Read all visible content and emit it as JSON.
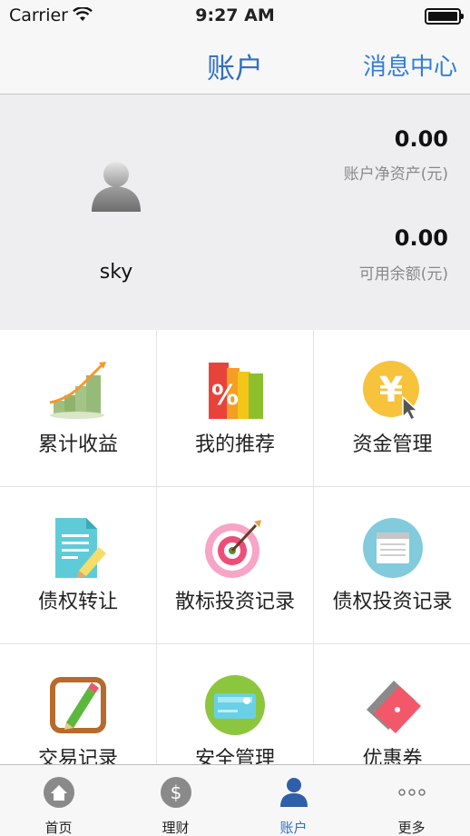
{
  "status_bar": {
    "carrier": "Carrier",
    "time": "9:27 AM"
  },
  "navbar": {
    "title": "账户",
    "right_button": "消息中心"
  },
  "account": {
    "username": "sky",
    "net_assets_value": "0.00",
    "net_assets_label": "账户净资产(元)",
    "balance_value": "0.00",
    "balance_label": "可用余额(元)"
  },
  "menu": [
    {
      "label": "累计收益",
      "icon": "earnings-chart-icon"
    },
    {
      "label": "我的推荐",
      "icon": "recommend-percent-icon"
    },
    {
      "label": "资金管理",
      "icon": "yen-coin-icon"
    },
    {
      "label": "债权转让",
      "icon": "document-edit-icon"
    },
    {
      "label": "散标投资记录",
      "icon": "target-dart-icon"
    },
    {
      "label": "债权投资记录",
      "icon": "record-list-icon"
    },
    {
      "label": "交易记录",
      "icon": "notepad-pencil-icon"
    },
    {
      "label": "安全管理",
      "icon": "security-card-icon"
    },
    {
      "label": "优惠券",
      "icon": "coupon-ticket-icon"
    }
  ],
  "tabs": [
    {
      "label": "首页",
      "icon": "home-icon"
    },
    {
      "label": "理财",
      "icon": "dollar-icon"
    },
    {
      "label": "账户",
      "icon": "person-icon",
      "active": true
    },
    {
      "label": "更多",
      "icon": "more-icon"
    }
  ],
  "colors": {
    "accent": "#2f6fc6",
    "header_bg": "#eeeef1"
  }
}
